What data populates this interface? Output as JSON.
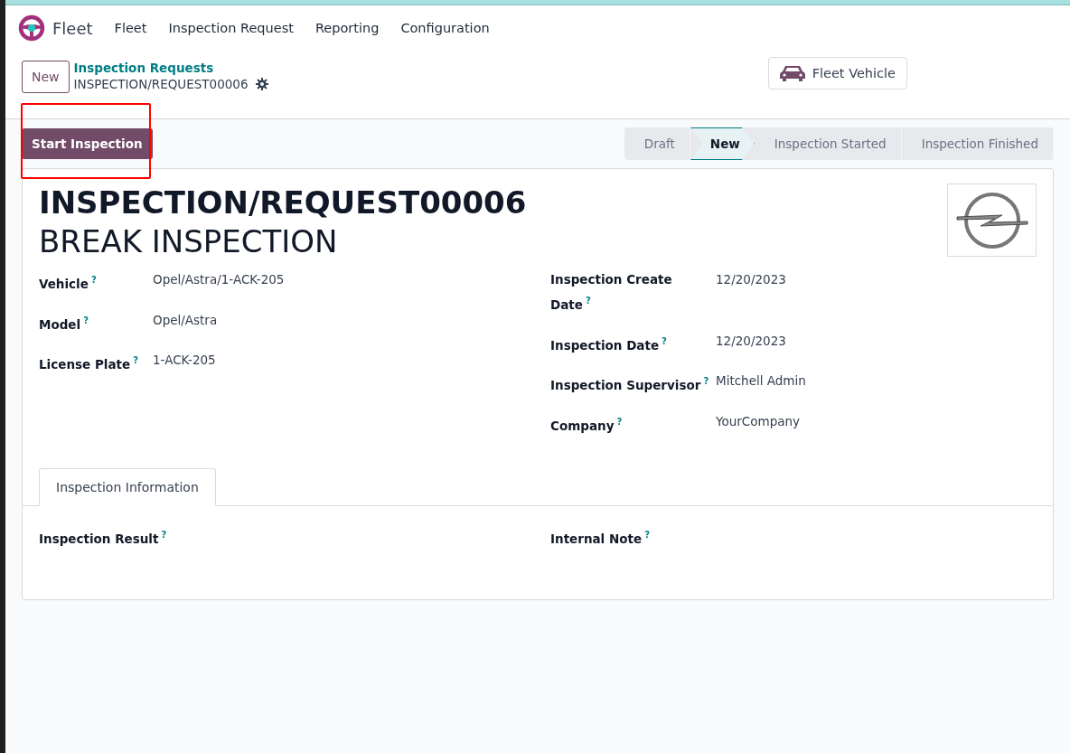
{
  "app": {
    "name": "Fleet"
  },
  "menu": [
    {
      "label": "Fleet"
    },
    {
      "label": "Inspection Request"
    },
    {
      "label": "Reporting"
    },
    {
      "label": "Configuration"
    }
  ],
  "breadcrumb": {
    "new_button": "New",
    "parent": "Inspection Requests",
    "current": "INSPECTION/REQUEST00006"
  },
  "smart_button": {
    "label": "Fleet Vehicle"
  },
  "action_button": {
    "label": "Start Inspection",
    "highlighted": true
  },
  "stages": [
    {
      "label": "Draft",
      "selected": false
    },
    {
      "label": "New",
      "selected": true
    },
    {
      "label": "Inspection Started",
      "selected": false
    },
    {
      "label": "Inspection Finished",
      "selected": false
    }
  ],
  "record": {
    "reference": "INSPECTION/REQUEST00006",
    "title": "BREAK INSPECTION"
  },
  "left_fields": [
    {
      "label": "Vehicle",
      "help": "?",
      "value": "Opel/Astra/1-ACK-205"
    },
    {
      "label": "Model",
      "help": "?",
      "value": "Opel/Astra"
    },
    {
      "label": "License Plate",
      "help": "?",
      "value": "1-ACK-205"
    }
  ],
  "right_fields": [
    {
      "label": "Inspection Create Date",
      "help": "?",
      "value": "12/20/2023"
    },
    {
      "label": "Inspection Date",
      "help": "?",
      "value": "12/20/2023"
    },
    {
      "label": "Inspection Supervisor",
      "help": "?",
      "value": "Mitchell Admin"
    },
    {
      "label": "Company",
      "help": "?",
      "value": "YourCompany"
    }
  ],
  "tabs": [
    {
      "label": "Inspection Information",
      "selected": true
    }
  ],
  "tab_fields": [
    {
      "label": "Inspection Result",
      "help": "?"
    },
    {
      "label": "Internal Note",
      "help": "?"
    }
  ]
}
